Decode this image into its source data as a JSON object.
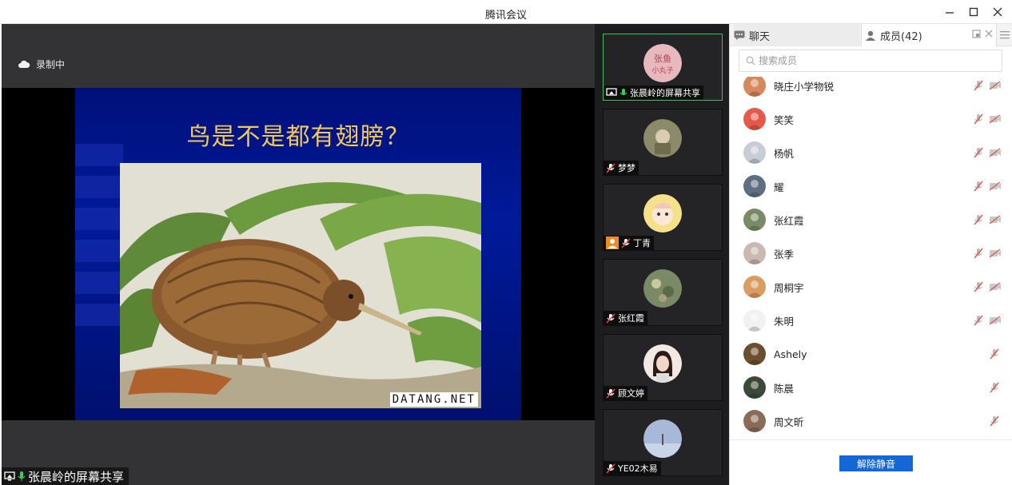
{
  "window": {
    "title": "腾讯会议"
  },
  "stage": {
    "recording_label": "录制中",
    "slide_title": "鸟是不是都有翅膀？",
    "photo_credit": "DATANG.NET",
    "share_label": "张晨岭的屏幕共享"
  },
  "thumbnails": [
    {
      "name": "张晨岭的屏幕共享",
      "avatar_text": "张鱼小丸子",
      "avatar_color": "#e7b8bd",
      "active": true,
      "sharing": true
    },
    {
      "name": "梦梦",
      "avatar_color": "#8b8a6a"
    },
    {
      "name": "丁青",
      "avatar_color": "#f7e08a",
      "has_profile_badge": true
    },
    {
      "name": "张红霞",
      "avatar_color": "#7a8a66"
    },
    {
      "name": "顾文婷",
      "avatar_color": "#f3e9e4"
    },
    {
      "name": "YE02木易",
      "avatar_color": "#a8b8d8"
    }
  ],
  "panel": {
    "tab_chat": "聊天",
    "tab_members": "成员(42)",
    "search_placeholder": "搜索成员",
    "members": [
      {
        "name": "晓庄小学物锐",
        "avatar_color": "#d5895d",
        "camera": true
      },
      {
        "name": "笑笑",
        "avatar_color": "#e35a4a",
        "camera": true
      },
      {
        "name": "杨帆",
        "avatar_color": "#c8ccd6",
        "camera": true
      },
      {
        "name": "耀",
        "avatar_color": "#5d6f80",
        "camera": true
      },
      {
        "name": "张红霞",
        "avatar_color": "#7a8a66",
        "camera": true
      },
      {
        "name": "张季",
        "avatar_color": "#c9b9b0",
        "camera": true
      },
      {
        "name": "周桐宇",
        "avatar_color": "#d99d62",
        "camera": true
      },
      {
        "name": "朱明",
        "avatar_color": "#f2f2f2",
        "camera": true
      },
      {
        "name": "Ashely",
        "avatar_color": "#6b4e2e",
        "camera": false
      },
      {
        "name": "陈晨",
        "avatar_color": "#3a4a3a",
        "camera": false
      },
      {
        "name": "周文昕",
        "avatar_color": "#8a6b58",
        "camera": false
      }
    ],
    "unmute_label": "解除静音"
  }
}
